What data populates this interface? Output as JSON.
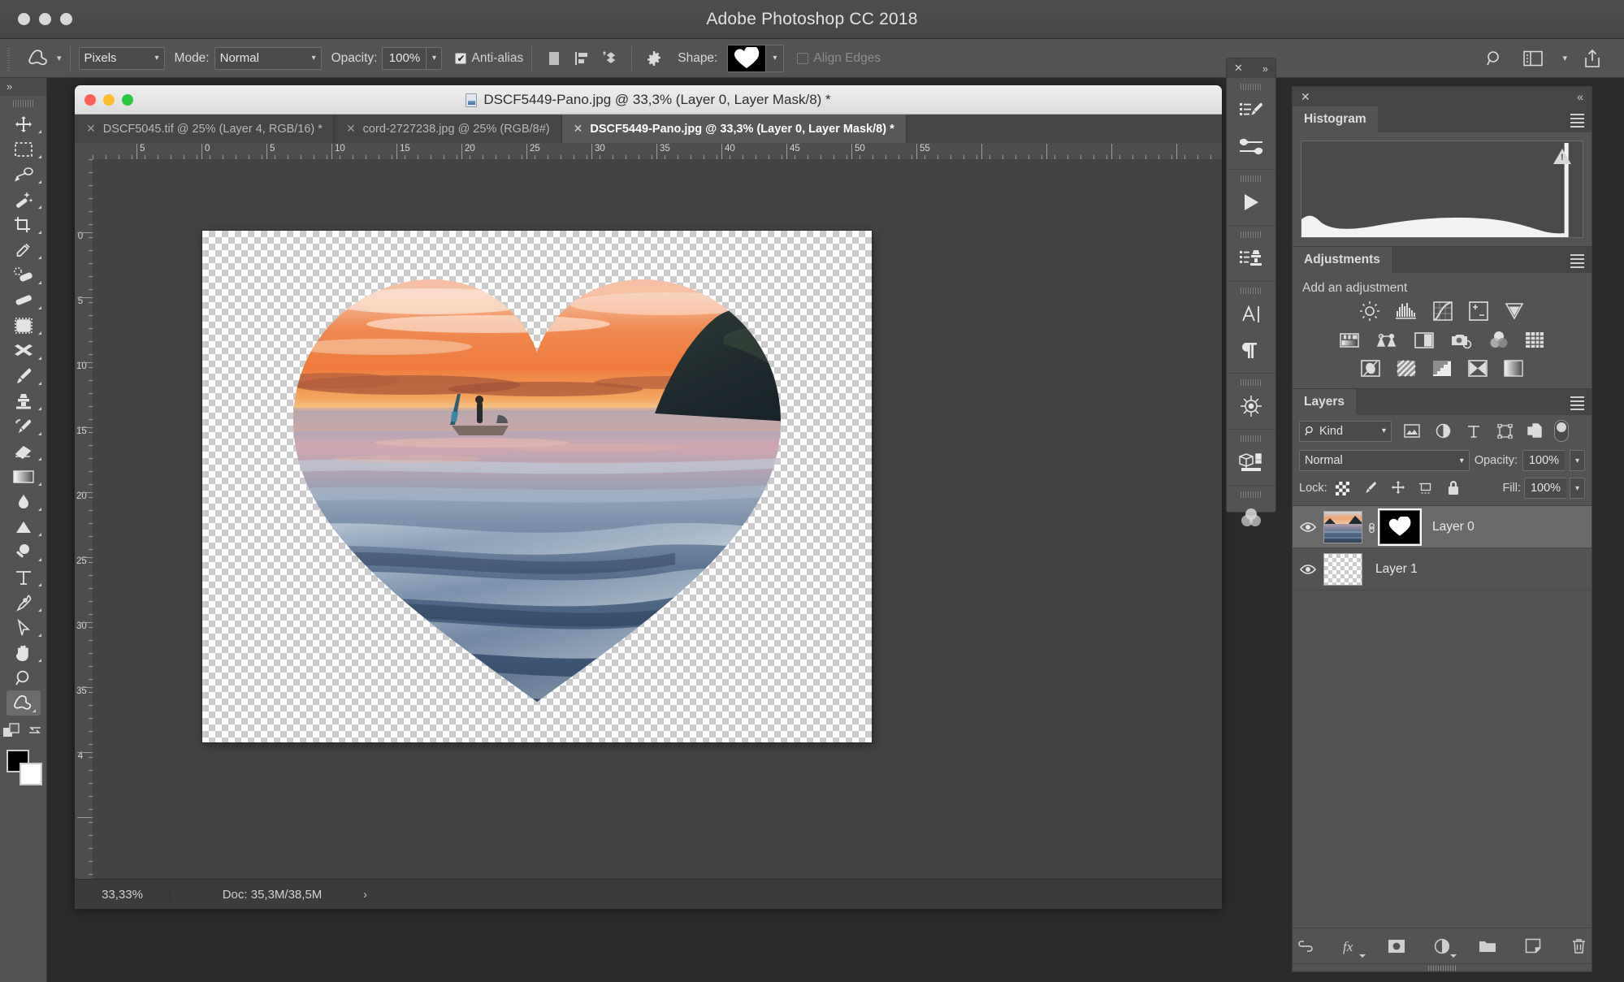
{
  "app": {
    "title": "Adobe Photoshop CC 2018"
  },
  "options_bar": {
    "tool_icon": "custom-shape-tool-icon",
    "fill_mode": "Pixels",
    "mode_label": "Mode:",
    "mode_value": "Normal",
    "opacity_label": "Opacity:",
    "opacity_value": "100%",
    "antialias_label": "Anti-alias",
    "shape_label": "Shape:",
    "align_edges_label": "Align Edges",
    "right_icons": [
      "search-icon",
      "workspace-switcher-icon",
      "chevron-down-icon",
      "share-icon"
    ]
  },
  "toolbar": {
    "expand_label": "»",
    "tools": [
      {
        "name": "move-tool",
        "icon": "move-icon"
      },
      {
        "name": "rectangular-marquee-tool",
        "icon": "marquee-icon"
      },
      {
        "name": "lasso-tool",
        "icon": "lasso-icon"
      },
      {
        "name": "object-selection-tool",
        "icon": "magic-wand-icon"
      },
      {
        "name": "crop-tool",
        "icon": "crop-icon"
      },
      {
        "name": "eyedropper-tool",
        "icon": "eyedropper-icon"
      },
      {
        "name": "spot-healing-brush-tool",
        "icon": "spot-healing-icon"
      },
      {
        "name": "patch-tool",
        "icon": "bandage-icon"
      },
      {
        "name": "frame-tool",
        "icon": "frame-icon"
      },
      {
        "name": "mixer-brush-tool",
        "icon": "arrows-cross-icon"
      },
      {
        "name": "brush-tool",
        "icon": "brush-icon"
      },
      {
        "name": "clone-stamp-tool",
        "icon": "stamp-icon"
      },
      {
        "name": "history-brush-tool",
        "icon": "history-brush-icon"
      },
      {
        "name": "eraser-tool",
        "icon": "eraser-icon"
      },
      {
        "name": "gradient-tool",
        "icon": "gradient-icon"
      },
      {
        "name": "blur-tool",
        "icon": "droplet-icon"
      },
      {
        "name": "dodge-tool",
        "icon": "triangle-icon"
      },
      {
        "name": "burn-tool",
        "icon": "dodge-circle-icon"
      },
      {
        "name": "type-tool",
        "icon": "type-T-icon"
      },
      {
        "name": "pen-tool",
        "icon": "pen-icon"
      },
      {
        "name": "path-selection-tool",
        "icon": "arrow-cursor-icon"
      },
      {
        "name": "hand-tool",
        "icon": "hand-icon"
      },
      {
        "name": "zoom-tool",
        "icon": "magnifier-icon"
      },
      {
        "name": "custom-shape-tool",
        "icon": "custom-shape-icon",
        "selected": true
      }
    ],
    "swap_colors_icon": "swap-colors-icon",
    "default_colors_icon": "default-colors-icon",
    "foreground_color": "#000000",
    "background_color": "#ffffff"
  },
  "document": {
    "window_title": "DSCF5449-Pano.jpg @ 33,3% (Layer 0, Layer Mask/8) *",
    "tabs": [
      {
        "label": "DSCF5045.tif @ 25% (Layer 4, RGB/16) *",
        "active": false
      },
      {
        "label": "cord-2727238.jpg @ 25% (RGB/8#)",
        "active": false
      },
      {
        "label": "DSCF5449-Pano.jpg @ 33,3% (Layer 0, Layer Mask/8) *",
        "active": true
      }
    ],
    "ruler_h_labels": [
      "5",
      "0",
      "5",
      "10",
      "15",
      "20",
      "25",
      "30",
      "35",
      "40",
      "45",
      "50",
      "55"
    ],
    "ruler_v_labels": [
      "0",
      "5",
      "10",
      "15",
      "20",
      "25",
      "30",
      "35",
      "4"
    ]
  },
  "statusbar": {
    "zoom": "33,33%",
    "doc_info": "Doc: 35,3M/38,5M",
    "expand_arrow": "›"
  },
  "minidock": {
    "close_icon": "close-icon",
    "expand_icon": "expand-icon",
    "groups": [
      {
        "items": [
          {
            "name": "brushes-panel",
            "icon": "brushes-icon"
          },
          {
            "name": "brush-settings-panel",
            "icon": "brush-settings-icon"
          }
        ]
      },
      {
        "items": [
          {
            "name": "actions-panel",
            "icon": "play-icon"
          }
        ]
      },
      {
        "items": [
          {
            "name": "clone-source-panel",
            "icon": "clone-source-icon"
          }
        ]
      },
      {
        "items": [
          {
            "name": "character-panel",
            "icon": "character-A-icon"
          },
          {
            "name": "paragraph-panel",
            "icon": "pilcrow-icon"
          }
        ]
      },
      {
        "items": [
          {
            "name": "navigator-panel",
            "icon": "ships-wheel-icon"
          }
        ]
      },
      {
        "items": [
          {
            "name": "3d-panel",
            "icon": "cube-icon"
          }
        ]
      },
      {
        "items": [
          {
            "name": "channels-panel",
            "icon": "color-circles-icon"
          }
        ]
      }
    ]
  },
  "histogram_panel": {
    "close_icon": "close-icon",
    "collapse_icon": "collapse-icon",
    "tab_label": "Histogram",
    "menu_icon": "panel-menu-icon",
    "warning_icon": "cached-data-warning-icon"
  },
  "adjustments_panel": {
    "tab_label": "Adjustments",
    "menu_icon": "panel-menu-icon",
    "heading": "Add an adjustment",
    "rows": [
      [
        {
          "name": "brightness-contrast-adjustment",
          "icon": "brightness-contrast-icon"
        },
        {
          "name": "levels-adjustment",
          "icon": "levels-icon"
        },
        {
          "name": "curves-adjustment",
          "icon": "curves-icon"
        },
        {
          "name": "exposure-adjustment",
          "icon": "exposure-icon"
        },
        {
          "name": "vibrance-adjustment",
          "icon": "vibrance-icon"
        }
      ],
      [
        {
          "name": "hue-saturation-adjustment",
          "icon": "hue-saturation-icon"
        },
        {
          "name": "color-balance-adjustment",
          "icon": "color-balance-icon"
        },
        {
          "name": "black-white-adjustment",
          "icon": "black-white-icon"
        },
        {
          "name": "photo-filter-adjustment",
          "icon": "photo-filter-icon"
        },
        {
          "name": "channel-mixer-adjustment",
          "icon": "channel-mixer-icon"
        },
        {
          "name": "color-lookup-adjustment",
          "icon": "color-lookup-icon"
        }
      ],
      [
        {
          "name": "invert-adjustment",
          "icon": "invert-icon"
        },
        {
          "name": "posterize-adjustment",
          "icon": "posterize-icon"
        },
        {
          "name": "threshold-adjustment",
          "icon": "threshold-icon"
        },
        {
          "name": "selective-color-adjustment",
          "icon": "selective-color-icon"
        },
        {
          "name": "gradient-map-adjustment",
          "icon": "gradient-map-icon"
        }
      ]
    ]
  },
  "layers_panel": {
    "tab_label": "Layers",
    "menu_icon": "panel-menu-icon",
    "filter_kind": "Kind",
    "filter_search_icon": "search-icon",
    "filter_icons": [
      {
        "name": "filter-pixel-layers",
        "icon": "image-icon"
      },
      {
        "name": "filter-adjustment-layers",
        "icon": "half-circle-icon"
      },
      {
        "name": "filter-type-layers",
        "icon": "type-T-icon"
      },
      {
        "name": "filter-shape-layers",
        "icon": "shape-bounds-icon"
      },
      {
        "name": "filter-smart-objects",
        "icon": "smart-object-icon"
      }
    ],
    "filter_toggle": "filter-enable-toggle",
    "blend_mode": "Normal",
    "opacity_label": "Opacity:",
    "opacity_value": "100%",
    "lock_label": "Lock:",
    "lock_icons": [
      {
        "name": "lock-transparent-pixels",
        "icon": "checkerboard-icon"
      },
      {
        "name": "lock-image-pixels",
        "icon": "brush-icon"
      },
      {
        "name": "lock-position",
        "icon": "move-arrows-icon"
      },
      {
        "name": "lock-artboard-nesting",
        "icon": "artboard-icon"
      },
      {
        "name": "lock-all",
        "icon": "padlock-icon"
      }
    ],
    "fill_label": "Fill:",
    "fill_value": "100%",
    "layers": [
      {
        "name": "Layer 0",
        "visible": true,
        "selected": true,
        "has_mask": true,
        "mask_shape": "heart",
        "linked": true,
        "thumb_type": "photo"
      },
      {
        "name": "Layer 1",
        "visible": true,
        "selected": false,
        "has_mask": false,
        "linked": false,
        "thumb_type": "transparent"
      }
    ],
    "footer_icons": [
      {
        "name": "link-layers-button",
        "icon": "link-icon"
      },
      {
        "name": "layer-style-button",
        "icon": "fx-icon"
      },
      {
        "name": "add-layer-mask-button",
        "icon": "mask-icon"
      },
      {
        "name": "new-adjustment-layer-button",
        "icon": "half-circle-icon"
      },
      {
        "name": "new-group-button",
        "icon": "folder-icon"
      },
      {
        "name": "new-layer-button",
        "icon": "new-layer-icon"
      },
      {
        "name": "delete-layer-button",
        "icon": "trash-icon"
      }
    ]
  },
  "canvas": {
    "artboard_label": "transparent-checkerboard-artboard",
    "masked_image": "sunset-seascape-heart-mask"
  }
}
